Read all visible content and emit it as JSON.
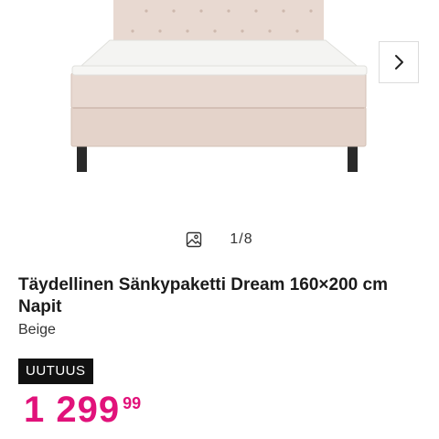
{
  "gallery": {
    "image_alt": "Täydellinen Sänkypaketti Dream 160×200 cm Napit",
    "next_icon": "chevron-right-icon",
    "counter_icon": "image-icon",
    "counter": "1/8"
  },
  "product": {
    "title": "Täydellinen Sänkypaketti Dream 160×200 cm Napit",
    "variant": "Beige",
    "badge": "UUTUUS",
    "price_main": "1 299",
    "price_cents": "99"
  },
  "colors": {
    "price": "#e1127a",
    "badge_bg": "#111111",
    "bed_fabric": "#e8d9d1"
  }
}
